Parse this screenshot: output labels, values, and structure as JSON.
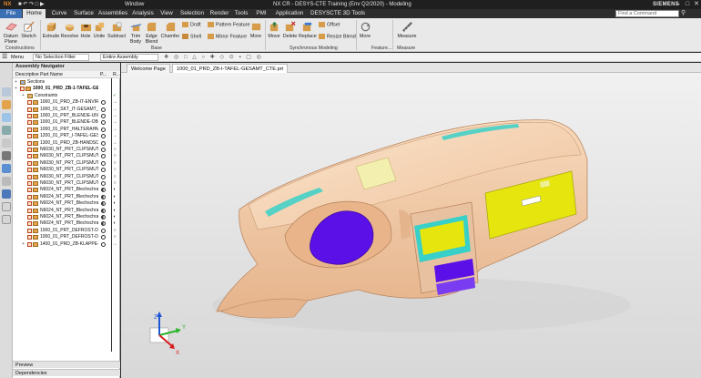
{
  "titlebar": {
    "app_title": "NX CR - DESYS-CTE Training (Env Q2/2020) - Modeling",
    "window_menu": "Window",
    "brand": "SIEMENS",
    "minimize": "–",
    "maximize": "□",
    "close": "✕"
  },
  "tabs": [
    "File",
    "Home",
    "Curve",
    "Surface",
    "Assemblies",
    "Analysis",
    "View",
    "Selection",
    "Render",
    "Tools",
    "PMI",
    "Application",
    "DESYSCTE 3D Tools"
  ],
  "active_tab": "Home",
  "command_search": {
    "placeholder": "Find a Command"
  },
  "ribbon": {
    "construction": {
      "label": "Constructions",
      "buttons": [
        "Datum Plane",
        "Sketch"
      ]
    },
    "features": [
      "Extrude",
      "Revolve",
      "Hole",
      "Unite",
      "Subtract",
      "Trim Body",
      "Edge Blend",
      "Chamfer"
    ],
    "base_label": "Base",
    "base_small": [
      "Draft",
      "Shell",
      "Pattern Feature",
      "Mirror Feature"
    ],
    "more_label": "More",
    "sync": {
      "label": "Synchronous Modeling",
      "buttons": [
        "Move",
        "Delete",
        "Replace"
      ],
      "small": [
        "Offset",
        "Resize Blend"
      ]
    },
    "feature_more": {
      "label": "Feature...",
      "button": "More"
    },
    "measure": {
      "label": "Measure",
      "button": "Measure"
    }
  },
  "selection_bar": {
    "menu": "Menu",
    "filter": "No Selection Filter",
    "scope": "Entire Assembly"
  },
  "navigator": {
    "title": "Assembly Navigator",
    "columns": [
      "Descriptive Part Name",
      "P...",
      "R..."
    ],
    "rows": [
      {
        "name": "Sections",
        "indent": 0,
        "kind": "section",
        "m1": "none",
        "m2": ""
      },
      {
        "name": "1000_01_PRD_ZB-1-TAFEL-GE...",
        "indent": 0,
        "kind": "assy",
        "m1": "none",
        "m2": "",
        "bold": true
      },
      {
        "name": "Constraints",
        "indent": 1,
        "kind": "constraints",
        "m1": "none",
        "m2": "✓"
      },
      {
        "name": "1000_01_PRD_ZB-IT-ENVIRO...",
        "indent": 1,
        "kind": "part",
        "m1": "open",
        "m2": "→"
      },
      {
        "name": "1000_01_SKT_IT-GESAMT_SK...",
        "indent": 1,
        "kind": "part",
        "m1": "open",
        "m2": "→"
      },
      {
        "name": "1000_01_PRT_BLENDE-UNTE...",
        "indent": 1,
        "kind": "part",
        "m1": "open",
        "m2": "→"
      },
      {
        "name": "1000_01_PRT_BLENDE-OBE...",
        "indent": 1,
        "kind": "part",
        "m1": "open",
        "m2": "→"
      },
      {
        "name": "1000_01_PRT_HALTERAHME...",
        "indent": 1,
        "kind": "part",
        "m1": "open",
        "m2": "→"
      },
      {
        "name": "1200_01_PRT_I-TAFEL-GESC...",
        "indent": 1,
        "kind": "part",
        "m1": "open",
        "m2": "→"
      },
      {
        "name": "1300_01_PRD_ZB-HANDSC...",
        "indent": 1,
        "kind": "part",
        "m1": "open",
        "m2": "→"
      },
      {
        "name": "N6030_NT_PRT_CLIPSMUTTE...",
        "indent": 1,
        "kind": "part",
        "m1": "open",
        "m2": "○"
      },
      {
        "name": "N6030_NT_PRT_CLIPSMUTTE...",
        "indent": 1,
        "kind": "part",
        "m1": "open",
        "m2": "○"
      },
      {
        "name": "N6030_NT_PRT_CLIPSMUTTE...",
        "indent": 1,
        "kind": "part",
        "m1": "open",
        "m2": "○"
      },
      {
        "name": "N6030_NT_PRT_CLIPSMUTTE...",
        "indent": 1,
        "kind": "part",
        "m1": "open",
        "m2": "○"
      },
      {
        "name": "N6030_NT_PRT_CLIPSMUTTE...",
        "indent": 1,
        "kind": "part",
        "m1": "open",
        "m2": "○"
      },
      {
        "name": "N6030_NT_PRT_CLIPSMUTTE...",
        "indent": 1,
        "kind": "part",
        "m1": "open",
        "m2": "○"
      },
      {
        "name": "N6024_NT_PRT_Blechschraub...",
        "indent": 1,
        "kind": "part",
        "m1": "half",
        "m2": "◐"
      },
      {
        "name": "N6024_NT_PRT_Blechschraub...",
        "indent": 1,
        "kind": "part",
        "m1": "half",
        "m2": "◐"
      },
      {
        "name": "N6024_NT_PRT_Blechschraub...",
        "indent": 1,
        "kind": "part",
        "m1": "half",
        "m2": "◐"
      },
      {
        "name": "N6024_NT_PRT_Blechschraub...",
        "indent": 1,
        "kind": "part",
        "m1": "half",
        "m2": "◐"
      },
      {
        "name": "N6024_NT_PRT_Blechschraub...",
        "indent": 1,
        "kind": "part",
        "m1": "half",
        "m2": "◐"
      },
      {
        "name": "N6024_NT_PRT_Blechschraub...",
        "indent": 1,
        "kind": "part",
        "m1": "half",
        "m2": "◐"
      },
      {
        "name": "1000_01_PRT_DEFROST-DUE...",
        "indent": 1,
        "kind": "part",
        "m1": "open",
        "m2": "○"
      },
      {
        "name": "1000_01_PRT_DEFROST-DUE...",
        "indent": 1,
        "kind": "part",
        "m1": "open",
        "m2": "○"
      },
      {
        "name": "1400_01_PRD_ZB-KLAPPE-...",
        "indent": 1,
        "kind": "part",
        "m1": "open",
        "m2": "→"
      }
    ],
    "footer_panels": [
      "Preview",
      "Dependencies"
    ]
  },
  "graphics_tabs": [
    "Welcome Page",
    "1000_01_PRD_ZB-I-TAFEL-GESAMT_CTE.prt"
  ],
  "colors": {
    "part_body": "#efc5a2",
    "display_purple": "#5b10e8",
    "display_yellow": "#e6e60e",
    "vent_cyan": "#38d0c8",
    "file_tab": "#3b6fb3",
    "axis_x": "#d81b1b",
    "axis_y": "#2bb52b",
    "axis_z": "#1f56d4"
  },
  "triad": {
    "z": "Z",
    "x": "X",
    "y": "Y"
  }
}
